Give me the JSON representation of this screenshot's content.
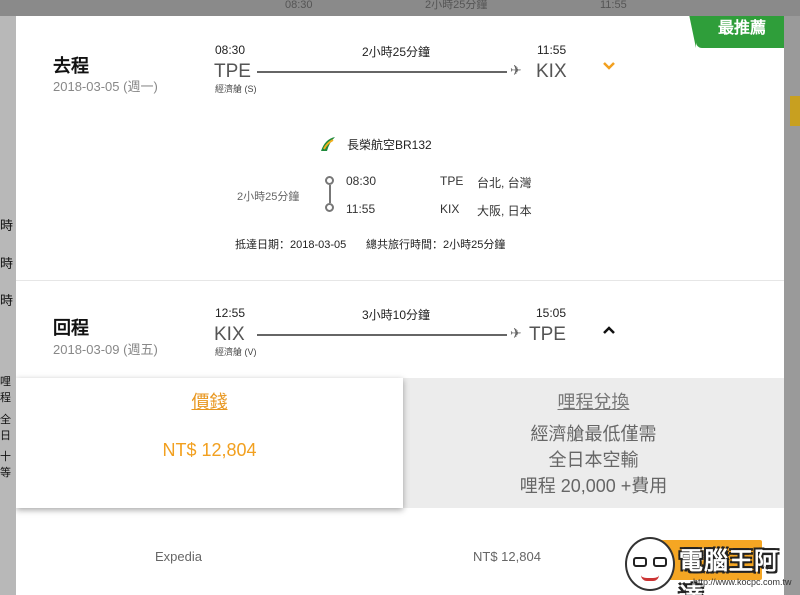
{
  "background": {
    "top_items": [
      "08:30",
      "2小時25分鐘",
      "11:55"
    ],
    "left_items": [
      "時",
      "時",
      "時",
      "哩程",
      "全日",
      "十等"
    ]
  },
  "badge": "最推薦",
  "outbound": {
    "label": "去程",
    "date": "2018-03-05 (週一)",
    "depart_time": "08:30",
    "arrive_time": "11:55",
    "duration": "2小時25分鐘",
    "from_code": "TPE",
    "to_code": "KIX",
    "cabin": "經濟艙 (S)",
    "chevron_icon": "chevron-down-icon",
    "detail": {
      "airline": "長榮航空BR132",
      "airline_icon": "eva-air-logo",
      "duration": "2小時25分鐘",
      "seg1_time": "08:30",
      "seg1_code": "TPE",
      "seg1_city": "台北, 台灣",
      "seg2_time": "11:55",
      "seg2_code": "KIX",
      "seg2_city": "大阪, 日本",
      "arrival_date": "抵達日期：2018-03-05",
      "total_time": "總共旅行時間：2小時25分鐘"
    }
  },
  "return": {
    "label": "回程",
    "date": "2018-03-09 (週五)",
    "depart_time": "12:55",
    "arrive_time": "15:05",
    "duration": "3小時10分鐘",
    "from_code": "KIX",
    "to_code": "TPE",
    "cabin": "經濟艙 (V)",
    "chevron_icon": "chevron-up-icon"
  },
  "price_panel": {
    "tab": "價錢",
    "value": "NT$ 12,804"
  },
  "mile_panel": {
    "tab": "哩程兌換",
    "line1": "經濟艙最低僅需",
    "line2": "全日本空輸",
    "line3": "哩程 20,000 +費用"
  },
  "booking": {
    "provider": "Expedia",
    "price": "NT$ 12,804",
    "button": "購買"
  },
  "watermark": {
    "text": "電腦王阿達",
    "url": "http://www.kocpc.com.tw"
  },
  "colors": {
    "accent_orange": "#f2a01f",
    "badge_green": "#2f9e3a"
  }
}
